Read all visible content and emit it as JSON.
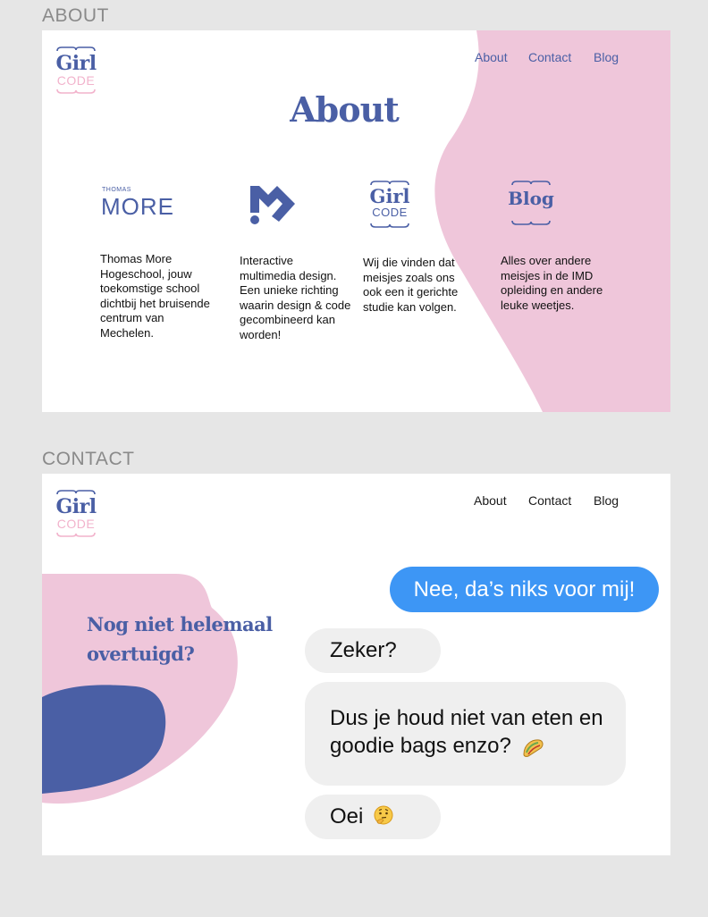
{
  "sections": {
    "about_label": "ABOUT",
    "contact_label": "CONTACT"
  },
  "logo": {
    "line1": "Girl",
    "line2": "CODE"
  },
  "nav": {
    "about": "About",
    "contact": "Contact",
    "blog": "Blog"
  },
  "about_page": {
    "title": "About",
    "columns": [
      {
        "icon": "thomas-more-logo",
        "logo_small": "THOMAS",
        "logo_big": "MORE",
        "text": "Thomas More Hogeschool, jouw toekomstige school dichtbij het bruisende centrum van Mechelen."
      },
      {
        "icon": "imd-m-logo",
        "text": "Interactive multimedia design. Een unieke richting waarin design & code gecombineerd kan worden!"
      },
      {
        "icon": "girl-code-logo",
        "logo_line1": "Girl",
        "logo_line2": "CODE",
        "text": "Wij die vinden dat meisjes zoals ons ook een it gerichte studie kan volgen."
      },
      {
        "icon": "blog-logo",
        "logo_word": "Blog",
        "text": "Alles over andere meisjes in de IMD opleiding en andere leuke weetjes."
      }
    ]
  },
  "contact_page": {
    "heading": "Nog niet helemaal overtuigd?",
    "messages": [
      {
        "side": "out",
        "text": "Nee, da’s niks voor mij!"
      },
      {
        "side": "in",
        "text": "Zeker?"
      },
      {
        "side": "in",
        "text": "Dus je houd niet van eten en goodie bags enzo?",
        "emoji": "taco"
      },
      {
        "side": "in",
        "text": "Oei",
        "emoji": "thinking-face"
      }
    ]
  },
  "colors": {
    "brand_blue": "#4a5fa5",
    "brand_pink": "#efc6da",
    "bubble_blue": "#3d96f5",
    "bubble_grey": "#efefef",
    "canvas": "#e6e6e6"
  }
}
